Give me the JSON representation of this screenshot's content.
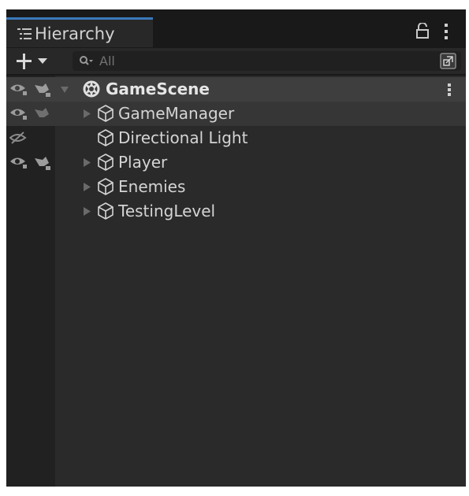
{
  "window": {
    "tab_title": "Hierarchy",
    "tab_icon": "list-icon",
    "tab_icons": [
      "lock-icon",
      "kebab-menu-icon"
    ]
  },
  "toolbar": {
    "create_icon": "plus-icon",
    "search_placeholder": "All",
    "search_icon": "search-icon",
    "toggle_icon": "scene-search-toggle-icon"
  },
  "hierarchy": {
    "scene": {
      "label": "GameScene",
      "icon": "unity-scene-icon",
      "expanded": true
    },
    "items": [
      {
        "label": "GameManager",
        "icon": "cube-icon",
        "has_children": true,
        "visibility": "visible",
        "pickable": true
      },
      {
        "label": "Directional Light",
        "icon": "cube-icon",
        "has_children": false,
        "visibility": "hidden",
        "pickable": true
      },
      {
        "label": "Player",
        "icon": "cube-icon",
        "has_children": true,
        "visibility": "visible",
        "pickable": true
      },
      {
        "label": "Enemies",
        "icon": "cube-icon",
        "has_children": true,
        "visibility": "visible",
        "pickable": true
      },
      {
        "label": "TestingLevel",
        "icon": "cube-icon",
        "has_children": true,
        "visibility": "visible",
        "pickable": true
      }
    ]
  },
  "colors": {
    "window_bg": "#191919",
    "panel_bg": "#2a2a2a",
    "gutter_bg": "#212121",
    "scene_row_bg": "#3e3e3e",
    "tab_accent": "#3a79bb",
    "text": "#d4d4d4"
  }
}
